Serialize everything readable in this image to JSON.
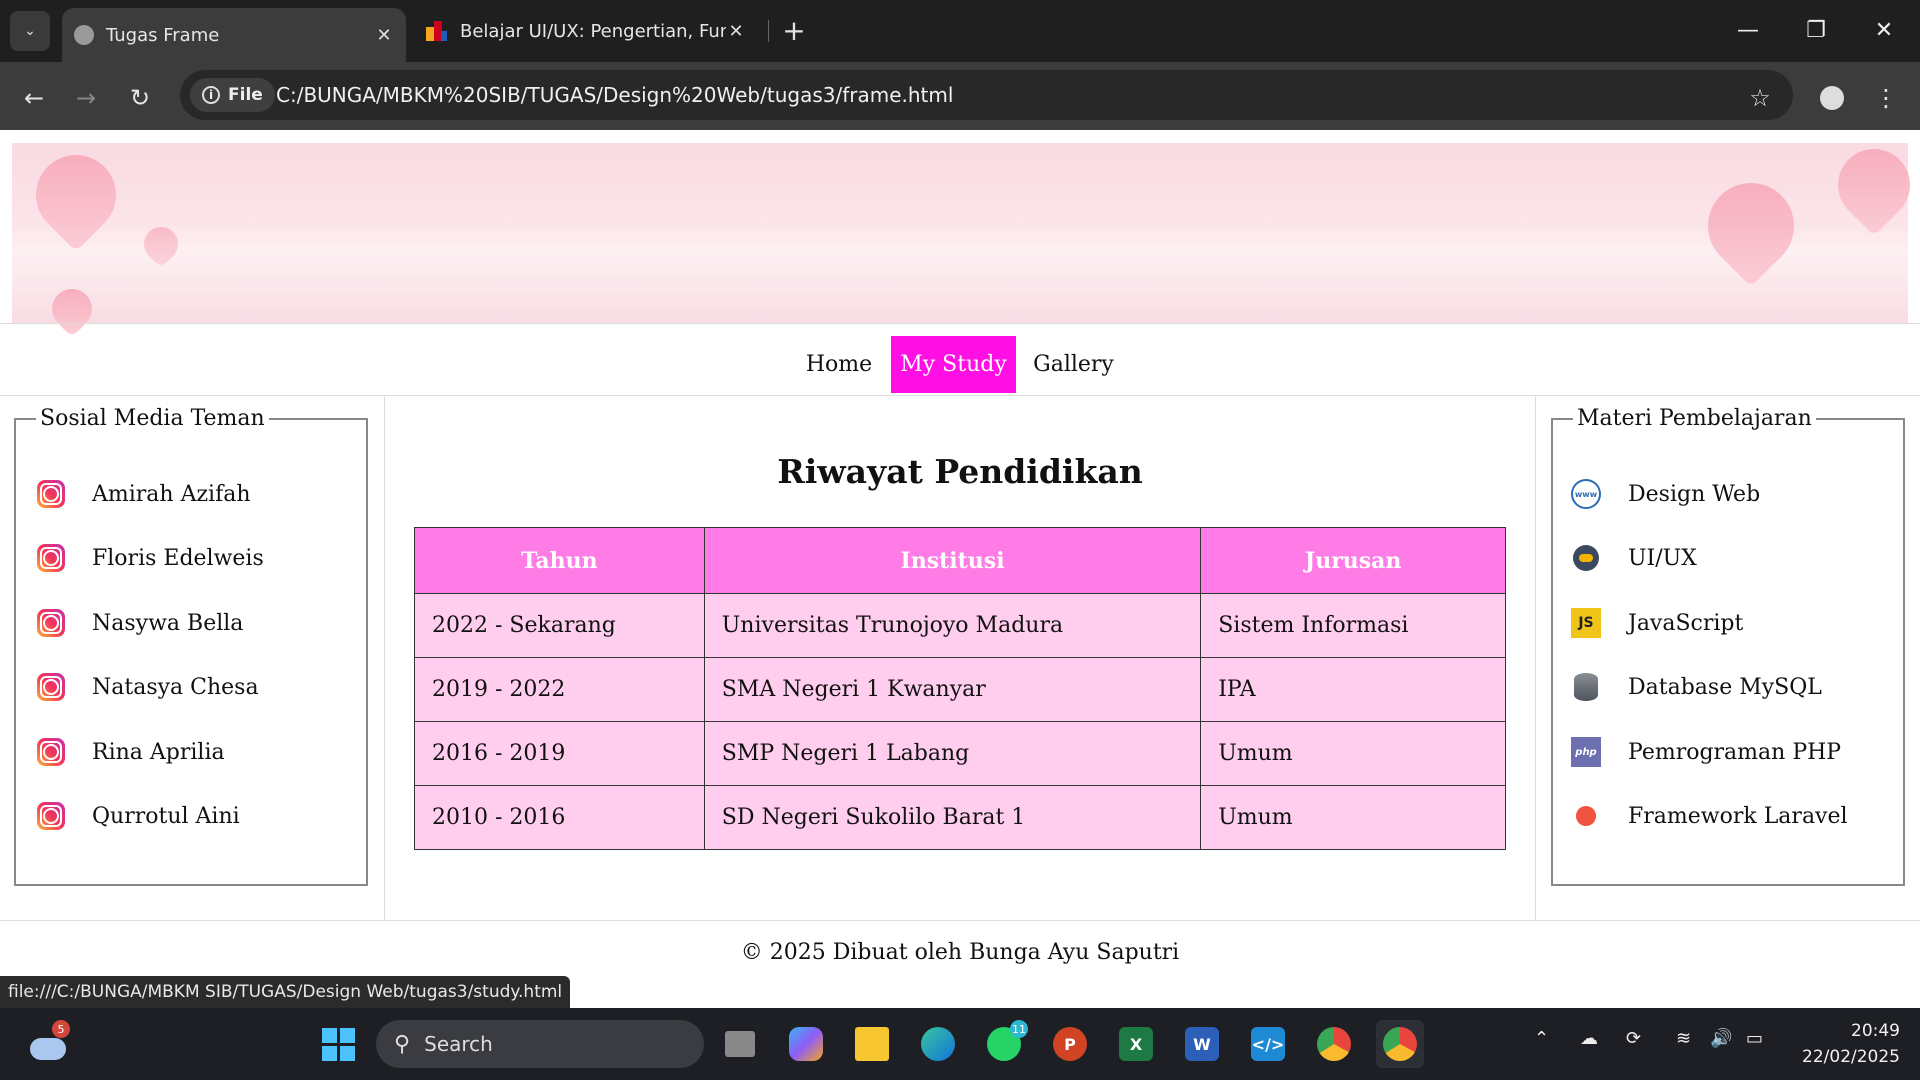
{
  "browser": {
    "tabs": [
      {
        "title": "Tugas Frame",
        "active": true
      },
      {
        "title": "Belajar UI/UX: Pengertian, Fung",
        "active": false
      }
    ],
    "file_chip": "File",
    "url": "C:/BUNGA/MBKM%20SIB/TUGAS/Design%20Web/tugas3/frame.html",
    "new_tab": "+",
    "close_glyph": "✕"
  },
  "nav": {
    "items": [
      {
        "label": "Home",
        "active": false
      },
      {
        "label": "My Study",
        "active": true
      },
      {
        "label": "Gallery",
        "active": false
      }
    ]
  },
  "sidebar_left": {
    "title": "Sosial Media Teman",
    "items": [
      "Amirah Azifah",
      "Floris Edelweis",
      "Nasywa Bella",
      "Natasya Chesa",
      "Rina Aprilia",
      "Qurrotul Aini"
    ]
  },
  "main": {
    "title": "Riwayat Pendidikan",
    "table": {
      "headers": [
        "Tahun",
        "Institusi",
        "Jurusan"
      ],
      "rows": [
        [
          "2022 - Sekarang",
          "Universitas Trunojoyo Madura",
          "Sistem Informasi"
        ],
        [
          "2019 - 2022",
          "SMA Negeri 1 Kwanyar",
          "IPA"
        ],
        [
          "2016 - 2019",
          "SMP Negeri 1 Labang",
          "Umum"
        ],
        [
          "2010 - 2016",
          "SD Negeri Sukolilo Barat 1",
          "Umum"
        ]
      ]
    }
  },
  "sidebar_right": {
    "title": "Materi Pembelajaran",
    "items": [
      {
        "label": "Design Web",
        "icon": "www-globe-icon"
      },
      {
        "label": "UI/UX",
        "icon": "uiux-icon"
      },
      {
        "label": "JavaScript",
        "icon": "js-icon"
      },
      {
        "label": "Database MySQL",
        "icon": "database-icon"
      },
      {
        "label": "Pemrograman PHP",
        "icon": "php-icon"
      },
      {
        "label": "Framework Laravel",
        "icon": "laravel-icon"
      }
    ]
  },
  "footer": {
    "text": "© 2025 Dibuat oleh Bunga Ayu Saputri"
  },
  "status_bar": {
    "text": "file:///C:/BUNGA/MBKM SIB/TUGAS/Design Web/tugas3/study.html"
  },
  "taskbar": {
    "search_label": "Search",
    "weather_badge": "5",
    "whatsapp_badge": "11",
    "time": "20:49",
    "date": "22/02/2025"
  },
  "colors": {
    "nav_active_bg": "#ff0fe3",
    "table_header_bg": "#ff7be6",
    "table_cell_bg": "#ffcdee"
  }
}
